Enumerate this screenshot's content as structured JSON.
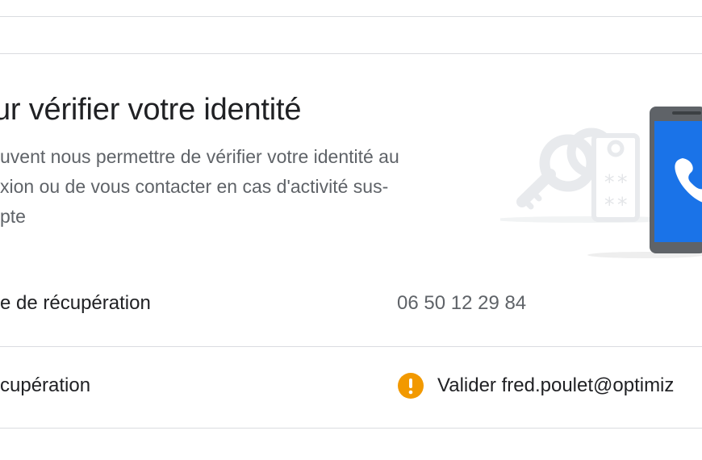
{
  "section": {
    "title": "ur vérifier votre identité",
    "description_lines": [
      "uvent nous permettre de vérifier votre identité au",
      "xion ou de vous contacter en cas d'activité sus-",
      "pte"
    ]
  },
  "rows": [
    {
      "label": "e de récupération",
      "value": "06 50 12 29 84"
    },
    {
      "label": "cupération",
      "value": "Valider fred.poulet@optimiz"
    }
  ],
  "colors": {
    "warning": "#F29900",
    "phone_screen": "#1A73E8",
    "divider": "#DADCE0"
  },
  "icons": {
    "warning": "warning-icon",
    "illustration_phone": "phone-call-icon",
    "illustration_keys": "keys-icon"
  }
}
